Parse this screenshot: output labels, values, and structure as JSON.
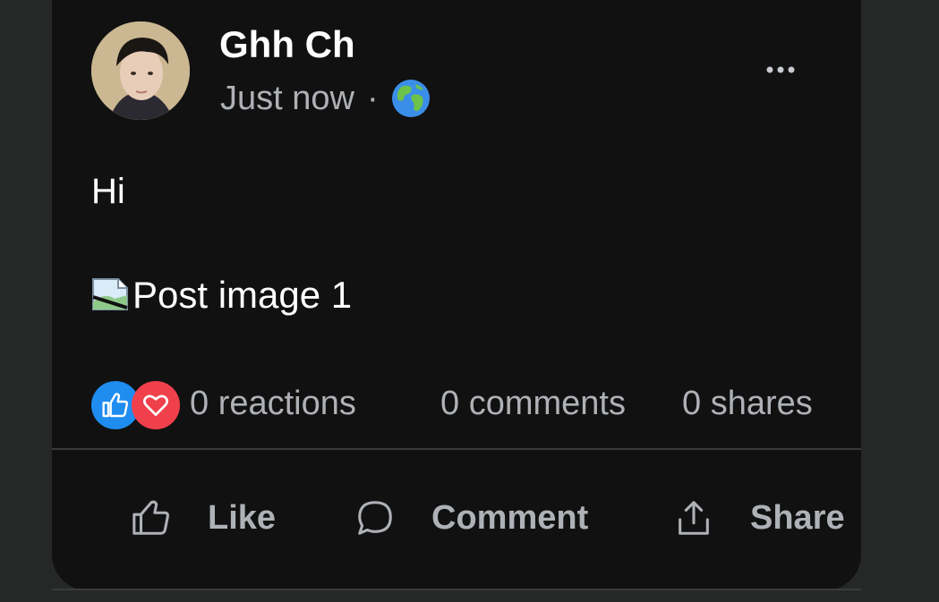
{
  "post": {
    "author_name": "Ghh Ch",
    "timestamp": "Just now",
    "separator": "·",
    "visibility_icon": "globe-icon",
    "text": "Hi",
    "image_alt": "Post image 1"
  },
  "stats": {
    "reactions": "0 reactions",
    "comments": "0 comments",
    "shares": "0 shares",
    "reaction_icons": [
      "like-icon",
      "heart-icon"
    ]
  },
  "actions": {
    "like_label": "Like",
    "comment_label": "Comment",
    "share_label": "Share"
  },
  "colors": {
    "card_bg": "#111111",
    "page_bg": "#262727",
    "like_blue": "#1f8cf0",
    "love_red": "#f0404c",
    "muted_text": "#aeb1b5"
  }
}
